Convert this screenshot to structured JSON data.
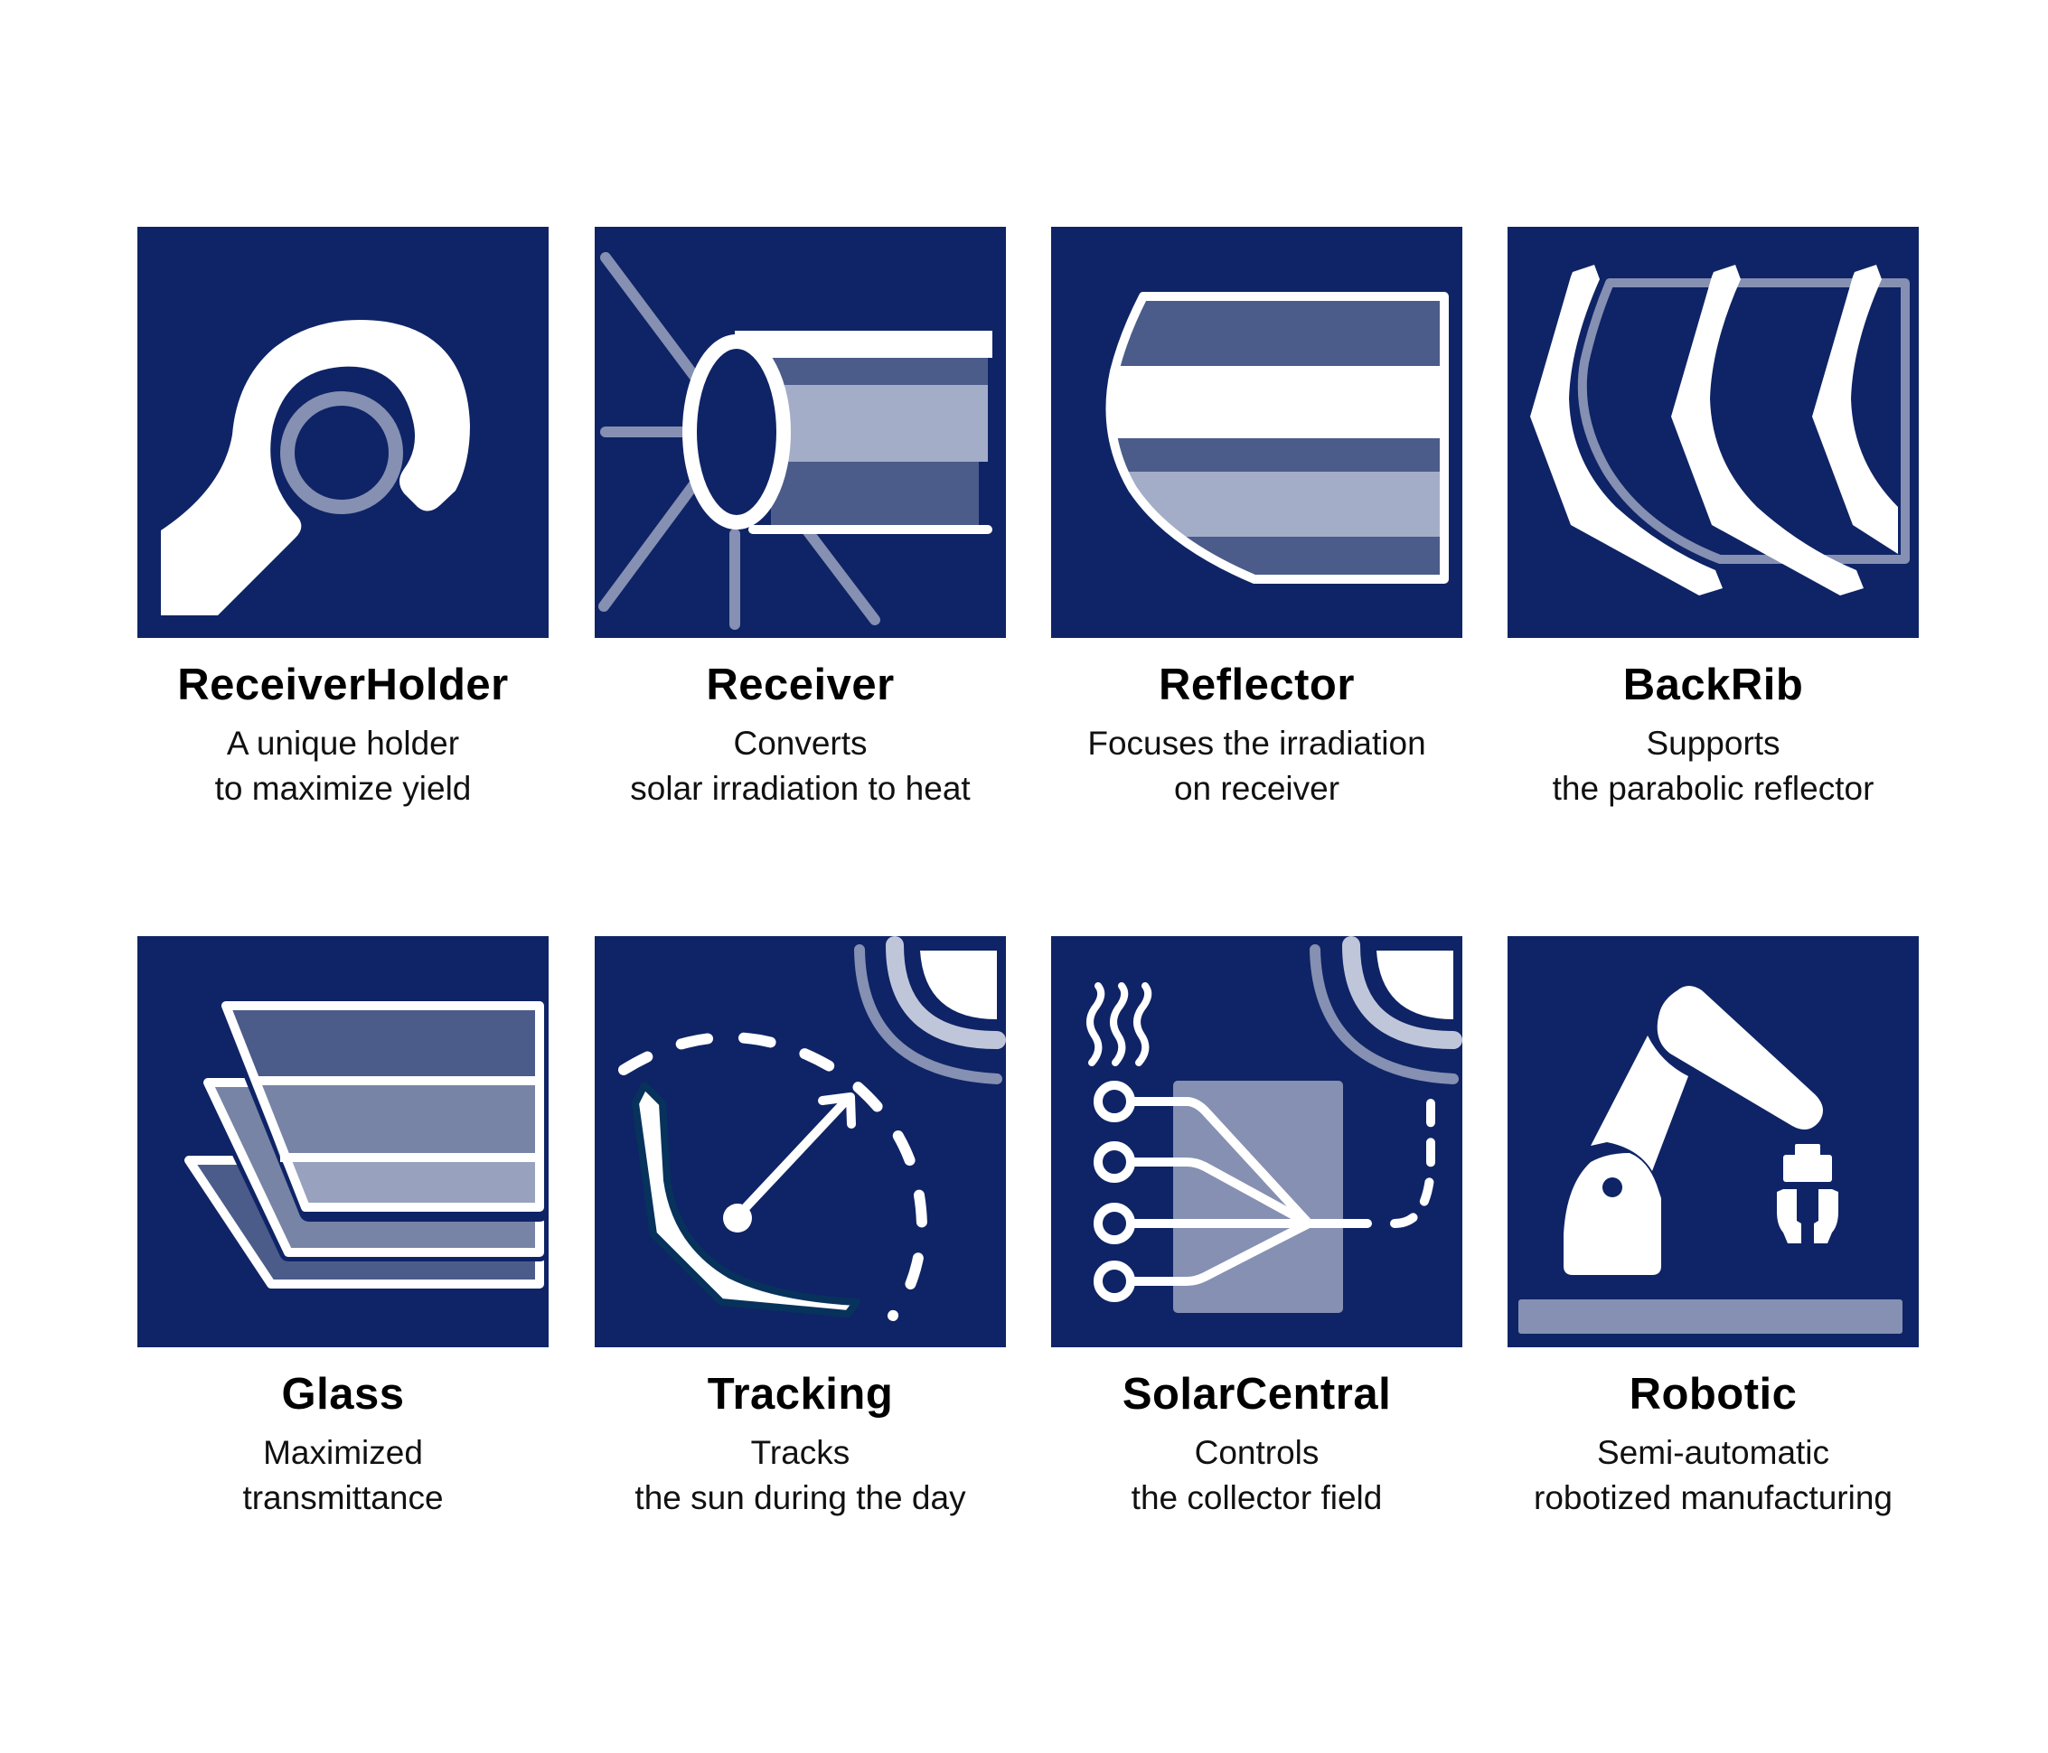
{
  "colors": {
    "tile_bg": "#0f2466",
    "white": "#ffffff",
    "mid_blue": "#4b5c8b",
    "light_blue": "#a3adc8",
    "faint_blue": "#8590b2",
    "pale_blue": "#c0c6da"
  },
  "features": [
    {
      "icon": "receiver-holder-icon",
      "title": "ReceiverHolder",
      "line1": "A unique holder",
      "line2": "to maximize yield"
    },
    {
      "icon": "receiver-tube-icon",
      "title": "Receiver",
      "line1": "Converts",
      "line2": "solar irradiation to heat"
    },
    {
      "icon": "reflector-icon",
      "title": "Reflector",
      "line1": "Focuses the irradiation",
      "line2": "on receiver"
    },
    {
      "icon": "back-rib-icon",
      "title": "BackRib",
      "line1": "Supports",
      "line2": "the parabolic reflector"
    },
    {
      "icon": "glass-panes-icon",
      "title": "Glass",
      "line1": "Maximized",
      "line2": "transmittance"
    },
    {
      "icon": "sun-tracking-icon",
      "title": "Tracking",
      "line1": "Tracks",
      "line2": "the sun during the day"
    },
    {
      "icon": "solar-central-icon",
      "title": "SolarCentral",
      "line1": "Controls",
      "line2": "the collector field"
    },
    {
      "icon": "robot-arm-icon",
      "title": "Robotic",
      "line1": "Semi-automatic",
      "line2": "robotized manufacturing"
    }
  ]
}
